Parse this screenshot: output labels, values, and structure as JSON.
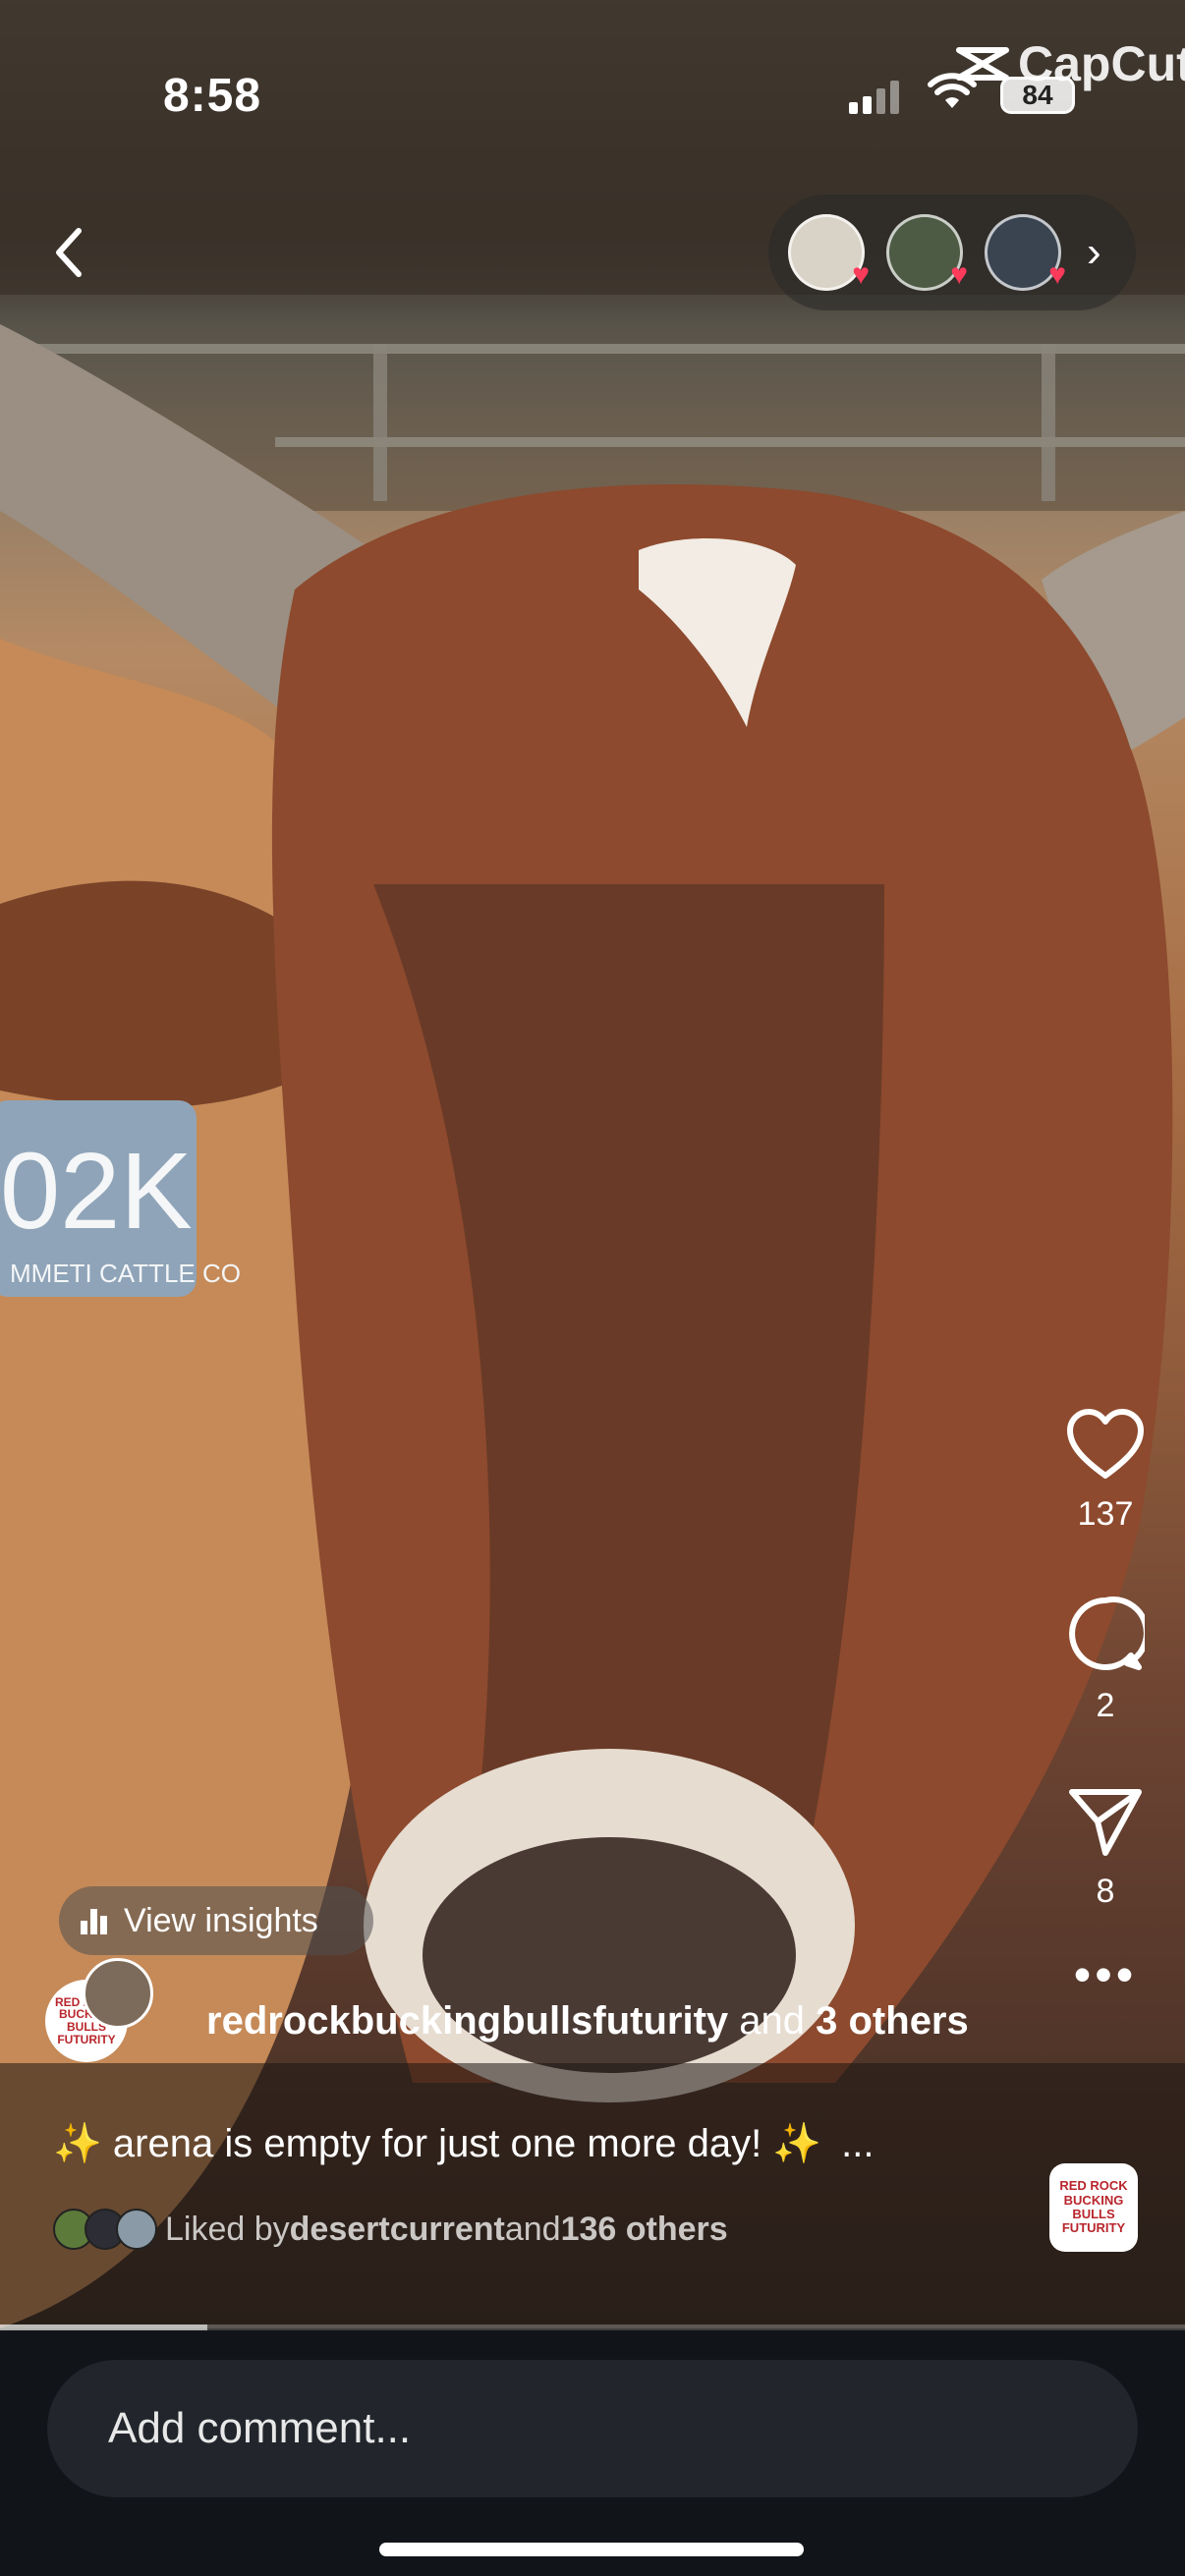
{
  "status_bar": {
    "time": "8:58",
    "battery": "84",
    "overlay_app": "CapCut"
  },
  "top_bar": {
    "back_icon": "chevron-left-icon",
    "viewer_avatars_count": 3,
    "more_chevron": "›"
  },
  "photo": {
    "ear_tag_text": "02K",
    "ear_tag_sub": "MMETI CATTLE CO"
  },
  "actions": {
    "like_count": "137",
    "comment_count": "2",
    "share_count": "8",
    "more_label": "•••"
  },
  "audio_thumb_text": "RED ROCK BUCKING BULLS FUTURITY",
  "insights": {
    "label": "View insights"
  },
  "author": {
    "avatar_text": "RED ROCK BUCKING BULLS FUTURITY",
    "name": "redrockbuckingbullsfuturity",
    "and": " and ",
    "others": "3 others"
  },
  "caption": {
    "sparkle_left": "✨",
    "text": " arena is empty for just one more day! ",
    "sparkle_right": "✨",
    "more": "..."
  },
  "liked": {
    "prefix": "Liked by ",
    "user": "desertcurrent",
    "middle": " and ",
    "others": "136 others"
  },
  "progress": {
    "fraction": 0.175
  },
  "comment": {
    "placeholder": "Add comment..."
  },
  "colors": {
    "heart": "#ff3b5c",
    "bottom_bg": "#111418",
    "comment_bg": "#22262c"
  }
}
